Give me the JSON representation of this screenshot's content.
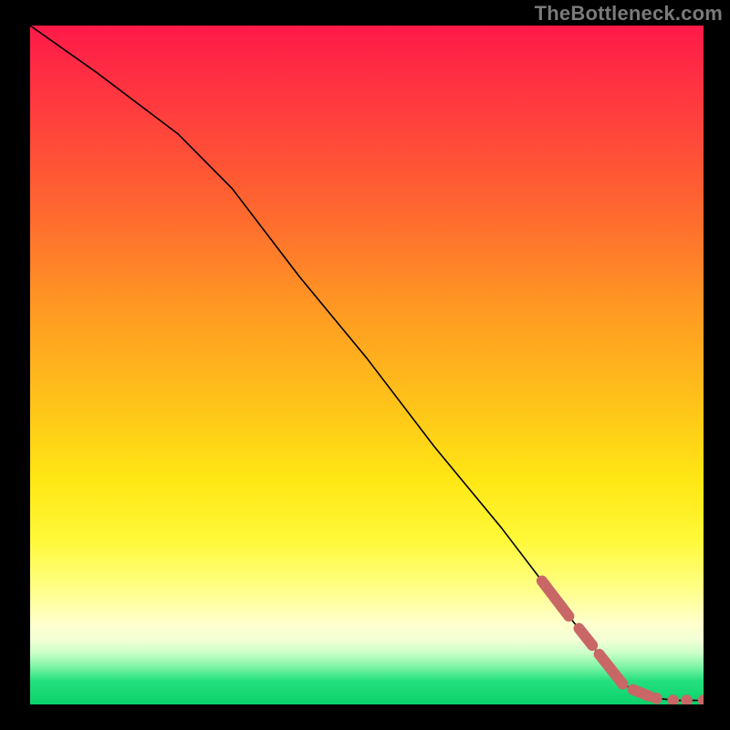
{
  "watermark": "TheBottleneck.com",
  "chart_data": {
    "type": "line",
    "title": "",
    "xlabel": "",
    "ylabel": "",
    "xlim": [
      0,
      100
    ],
    "ylim": [
      0,
      100
    ],
    "grid": false,
    "legend": false,
    "curve": {
      "x": [
        0,
        10,
        22,
        30,
        40,
        50,
        60,
        70,
        80,
        88,
        92,
        96,
        100
      ],
      "y": [
        100,
        93,
        84,
        76,
        63,
        51,
        38,
        26,
        13,
        3,
        1,
        0.6,
        0.6
      ]
    },
    "highlighted_segments": [
      {
        "x0": 76.0,
        "y0": 18.2,
        "x1": 80.0,
        "y1": 13.0
      },
      {
        "x0": 81.5,
        "y0": 11.2,
        "x1": 83.5,
        "y1": 8.7
      },
      {
        "x0": 84.5,
        "y0": 7.4,
        "x1": 88.0,
        "y1": 3.0
      },
      {
        "x0": 89.5,
        "y0": 2.2,
        "x1": 92.0,
        "y1": 1.2
      }
    ],
    "highlighted_points": [
      {
        "x": 93.0,
        "y": 0.9
      },
      {
        "x": 95.5,
        "y": 0.6
      },
      {
        "x": 97.5,
        "y": 0.6
      },
      {
        "x": 100.0,
        "y": 0.6
      }
    ]
  }
}
